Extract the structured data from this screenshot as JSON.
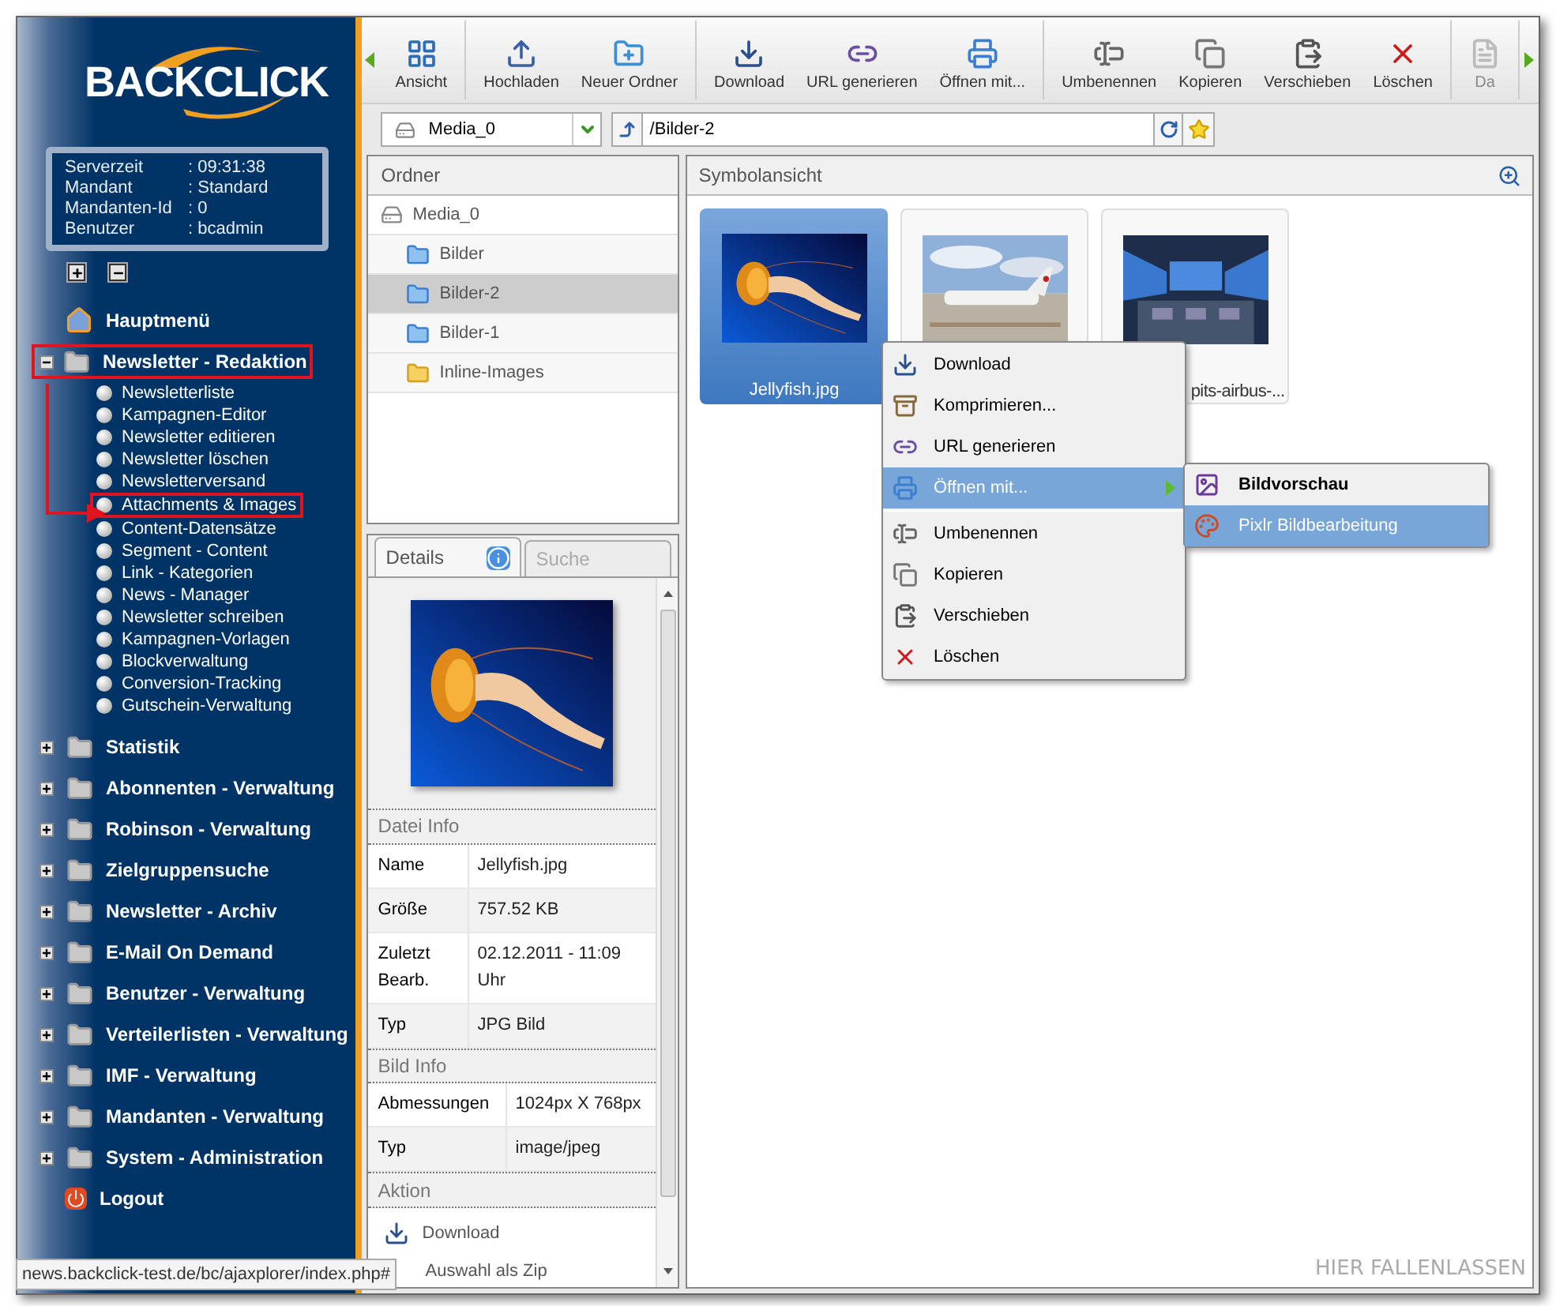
{
  "logo": "BACKCLICK",
  "server_info": [
    {
      "label": "Serverzeit",
      "value": ": 09:31:38"
    },
    {
      "label": "Mandant",
      "value": ": Standard"
    },
    {
      "label": "Mandanten-Id",
      "value": ": 0"
    },
    {
      "label": "Benutzer",
      "value": ": bcadmin"
    }
  ],
  "sidebar": {
    "items": [
      {
        "label": "Hauptmenü",
        "kind": "home"
      },
      {
        "label": "Newsletter - Redaktion",
        "kind": "group",
        "expanded": true,
        "highlighted": true,
        "children": [
          {
            "label": "Newsletterliste",
            "highlighted": false
          },
          {
            "label": "Kampagnen-Editor",
            "highlighted": false
          },
          {
            "label": "Newsletter editieren",
            "highlighted": false
          },
          {
            "label": "Newsletter löschen",
            "highlighted": false
          },
          {
            "label": "Newsletterversand",
            "highlighted": false
          },
          {
            "label": "Attachments & Images",
            "highlighted": true
          },
          {
            "label": "Content-Datensätze",
            "highlighted": false
          },
          {
            "label": "Segment - Content",
            "highlighted": false
          },
          {
            "label": "Link - Kategorien",
            "highlighted": false
          },
          {
            "label": "News - Manager",
            "highlighted": false
          },
          {
            "label": "Newsletter schreiben",
            "highlighted": false
          },
          {
            "label": "Kampagnen-Vorlagen",
            "highlighted": false
          },
          {
            "label": "Blockverwaltung",
            "highlighted": false
          },
          {
            "label": "Conversion-Tracking",
            "highlighted": false
          },
          {
            "label": "Gutschein-Verwaltung",
            "highlighted": false
          }
        ]
      },
      {
        "label": "Statistik",
        "kind": "group",
        "expanded": false,
        "highlighted": false
      },
      {
        "label": "Abonnenten - Verwaltung",
        "kind": "group",
        "expanded": false,
        "highlighted": false
      },
      {
        "label": "Robinson - Verwaltung",
        "kind": "group",
        "expanded": false,
        "highlighted": false
      },
      {
        "label": "Zielgruppensuche",
        "kind": "group",
        "expanded": false,
        "highlighted": false
      },
      {
        "label": "Newsletter - Archiv",
        "kind": "group",
        "expanded": false,
        "highlighted": false
      },
      {
        "label": "E-Mail On Demand",
        "kind": "group",
        "expanded": false,
        "highlighted": false
      },
      {
        "label": "Benutzer - Verwaltung",
        "kind": "group",
        "expanded": false,
        "highlighted": false
      },
      {
        "label": "Verteilerlisten - Verwaltung",
        "kind": "group",
        "expanded": false,
        "highlighted": false
      },
      {
        "label": "IMF - Verwaltung",
        "kind": "group",
        "expanded": false,
        "highlighted": false
      },
      {
        "label": "Mandanten - Verwaltung",
        "kind": "group",
        "expanded": false,
        "highlighted": false
      },
      {
        "label": "System - Administration",
        "kind": "group",
        "expanded": false,
        "highlighted": false
      },
      {
        "label": "Logout",
        "kind": "logout"
      }
    ]
  },
  "toolbar": {
    "groups": [
      [
        {
          "label": "Ansicht",
          "kind": "view",
          "disabled": false
        }
      ],
      [
        {
          "label": "Hochladen",
          "kind": "upload",
          "disabled": false
        },
        {
          "label": "Neuer Ordner",
          "kind": "folder",
          "disabled": false
        }
      ],
      [
        {
          "label": "Download",
          "kind": "download",
          "disabled": false
        },
        {
          "label": "URL generieren",
          "kind": "url",
          "disabled": false
        },
        {
          "label": "Öffnen mit...",
          "kind": "open",
          "disabled": false
        }
      ],
      [
        {
          "label": "Umbenennen",
          "kind": "rename",
          "disabled": false
        },
        {
          "label": "Kopieren",
          "kind": "copy",
          "disabled": false
        },
        {
          "label": "Verschieben",
          "kind": "move",
          "disabled": false
        },
        {
          "label": "Löschen",
          "kind": "delete",
          "disabled": false
        }
      ],
      [
        {
          "label": "Da",
          "kind": "other",
          "disabled": true
        }
      ]
    ]
  },
  "repository": "Media_0",
  "path": "/Bilder-2",
  "folders_panel": {
    "title": "Ordner",
    "tree": [
      {
        "label": "Media_0",
        "kind": "repo",
        "selected": false,
        "children": [
          {
            "label": "Bilder",
            "kind": "folder",
            "selected": false
          },
          {
            "label": "Bilder-2",
            "kind": "folder",
            "selected": true
          },
          {
            "label": "Bilder-1",
            "kind": "folder",
            "selected": false
          },
          {
            "label": "Inline-Images",
            "kind": "special",
            "selected": false
          }
        ]
      }
    ]
  },
  "details_tabs": [
    {
      "label": "Details",
      "selected": true
    },
    {
      "label": "Suche",
      "selected": false
    }
  ],
  "file_info": {
    "title": "Datei Info",
    "rows": [
      {
        "label": "Name",
        "value": "Jellyfish.jpg"
      },
      {
        "label": "Größe",
        "value": "757.52 KB"
      },
      {
        "label": "Zuletzt Bearb.",
        "value": "02.12.2011 - 11:09 Uhr"
      },
      {
        "label": "Typ",
        "value": "JPG Bild"
      }
    ]
  },
  "image_info": {
    "title": "Bild Info",
    "rows": [
      {
        "label": "Abmessungen",
        "value": "1024px X 768px"
      },
      {
        "label": "Typ",
        "value": "image/jpeg"
      }
    ]
  },
  "actions": {
    "title": "Aktion",
    "items": [
      {
        "label": "Download",
        "kind": "download"
      },
      {
        "label": "Auswahl als Zip",
        "kind": "zip"
      }
    ]
  },
  "view": {
    "title": "Symbolansicht",
    "files": [
      {
        "name": "Jellyfish.jpg",
        "selected": true
      },
      {
        "selected": false
      },
      {
        "name": "pits-airbus-...",
        "selected": false
      }
    ],
    "drop_hint": "HIER FALLENLASSEN"
  },
  "context_menu": [
    {
      "label": "Download",
      "kind": "download",
      "selected": false
    },
    {
      "label": "Komprimieren...",
      "kind": "zip",
      "selected": false
    },
    {
      "label": "URL generieren",
      "kind": "url",
      "selected": false
    },
    {
      "label": "Öffnen mit...",
      "kind": "open",
      "selected": true,
      "submenu": true
    },
    {
      "label": "Umbenennen",
      "kind": "rename",
      "selected": false
    },
    {
      "label": "Kopieren",
      "kind": "copy",
      "selected": false
    },
    {
      "label": "Verschieben",
      "kind": "move",
      "selected": false
    },
    {
      "label": "Löschen",
      "kind": "delete",
      "selected": false
    }
  ],
  "submenu": [
    {
      "label": "Bildvorschau",
      "kind": "preview",
      "selected": false
    },
    {
      "label": "Pixlr Bildbearbeitung",
      "kind": "editor",
      "selected": true
    }
  ],
  "status_bar": "news.backclick-test.de/bc/ajaxplorer/index.php#"
}
